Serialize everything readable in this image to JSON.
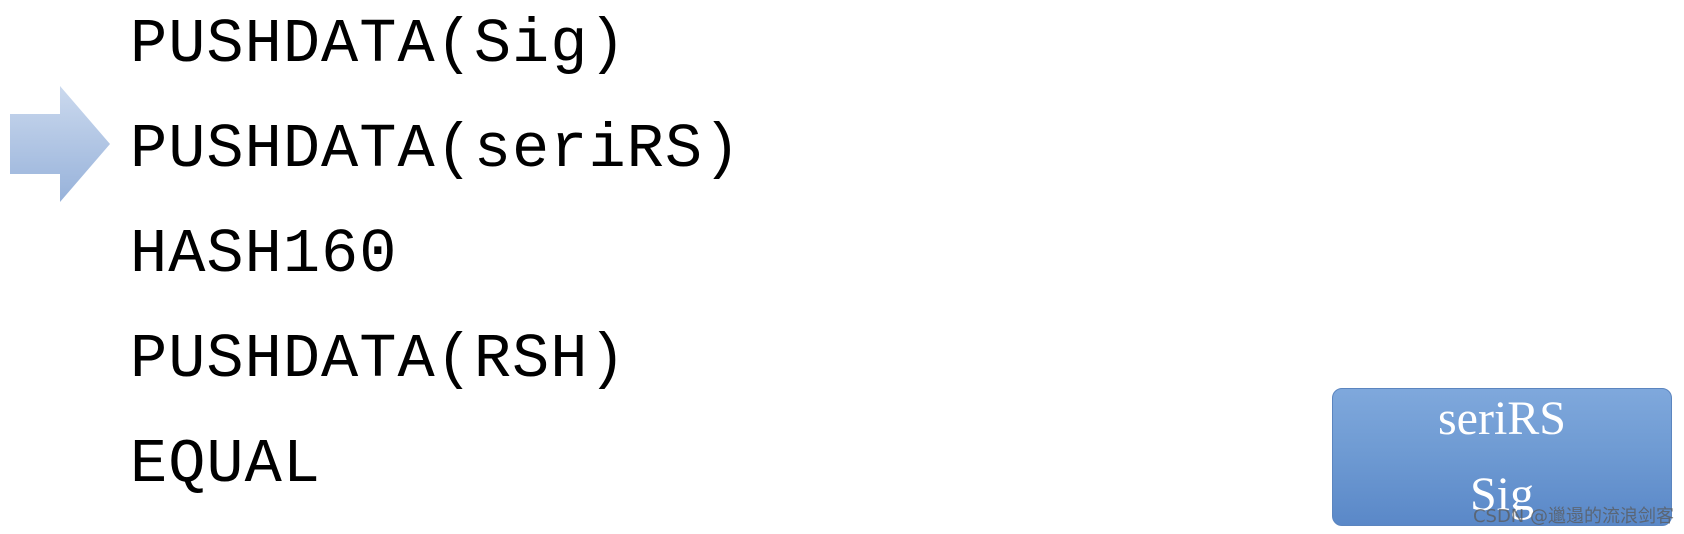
{
  "script": {
    "lines": [
      "PUSHDATA(Sig)",
      "PUSHDATA(seriRS)",
      "HASH160",
      "PUSHDATA(RSH)",
      "EQUAL"
    ],
    "current_line_index": 1
  },
  "arrow": {
    "icon": "right-arrow-icon",
    "color_light": "#c9d8ee",
    "color_dark": "#9ab4dc"
  },
  "stack": {
    "items": [
      "seriRS",
      "Sig"
    ],
    "color": "#6f9bd3"
  },
  "watermark": {
    "text": "CSDN @邋遢的流浪剑客"
  }
}
